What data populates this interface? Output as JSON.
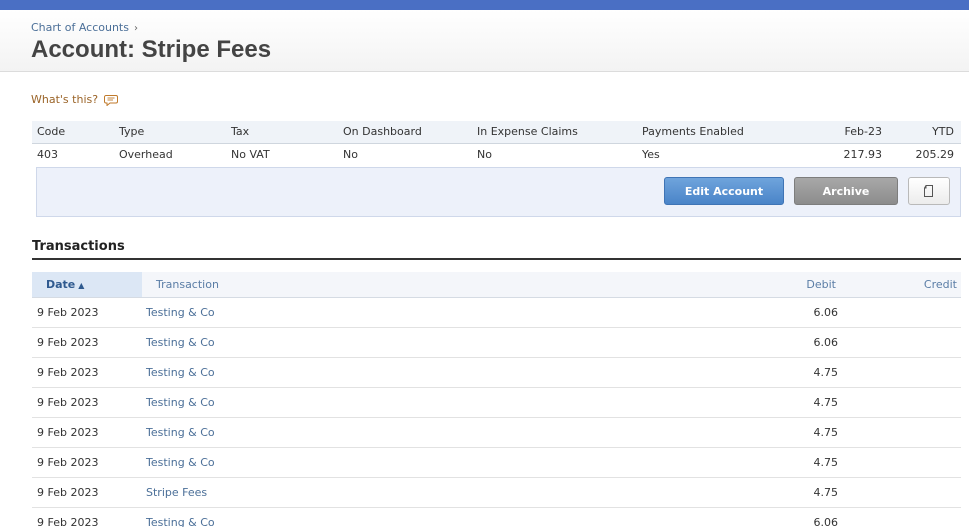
{
  "header": {
    "breadcrumb": "Chart of Accounts",
    "breadcrumb_sep": "›",
    "title": "Account: Stripe Fees"
  },
  "whats_this": "What's this?",
  "summary": {
    "headers": [
      "Code",
      "Type",
      "Tax",
      "On Dashboard",
      "In Expense Claims",
      "Payments Enabled",
      "Feb-23",
      "YTD"
    ],
    "values": [
      "403",
      "Overhead",
      "No VAT",
      "No",
      "No",
      "Yes",
      "217.93",
      "205.29"
    ]
  },
  "actions": {
    "edit": "Edit Account",
    "archive": "Archive"
  },
  "transactions": {
    "title": "Transactions",
    "columns": {
      "date": "Date",
      "sort_arrow": "▲",
      "transaction": "Transaction",
      "debit": "Debit",
      "credit": "Credit"
    },
    "rows": [
      {
        "date": "9 Feb 2023",
        "transaction": "Testing & Co",
        "debit": "6.06",
        "credit": ""
      },
      {
        "date": "9 Feb 2023",
        "transaction": "Testing & Co",
        "debit": "6.06",
        "credit": ""
      },
      {
        "date": "9 Feb 2023",
        "transaction": "Testing & Co",
        "debit": "4.75",
        "credit": ""
      },
      {
        "date": "9 Feb 2023",
        "transaction": "Testing & Co",
        "debit": "4.75",
        "credit": ""
      },
      {
        "date": "9 Feb 2023",
        "transaction": "Testing & Co",
        "debit": "4.75",
        "credit": ""
      },
      {
        "date": "9 Feb 2023",
        "transaction": "Testing & Co",
        "debit": "4.75",
        "credit": ""
      },
      {
        "date": "9 Feb 2023",
        "transaction": "Stripe Fees",
        "debit": "4.75",
        "credit": ""
      },
      {
        "date": "9 Feb 2023",
        "transaction": "Testing & Co",
        "debit": "6.06",
        "credit": ""
      }
    ]
  },
  "colors": {
    "top_strip": "#4a6fc4",
    "link": "#4b6f98",
    "primary_button": "#4a84c8",
    "archive_button": "#8c8c8c"
  },
  "icons": {
    "whats_this": "speech-bubble-icon",
    "copy": "copy-icon"
  }
}
